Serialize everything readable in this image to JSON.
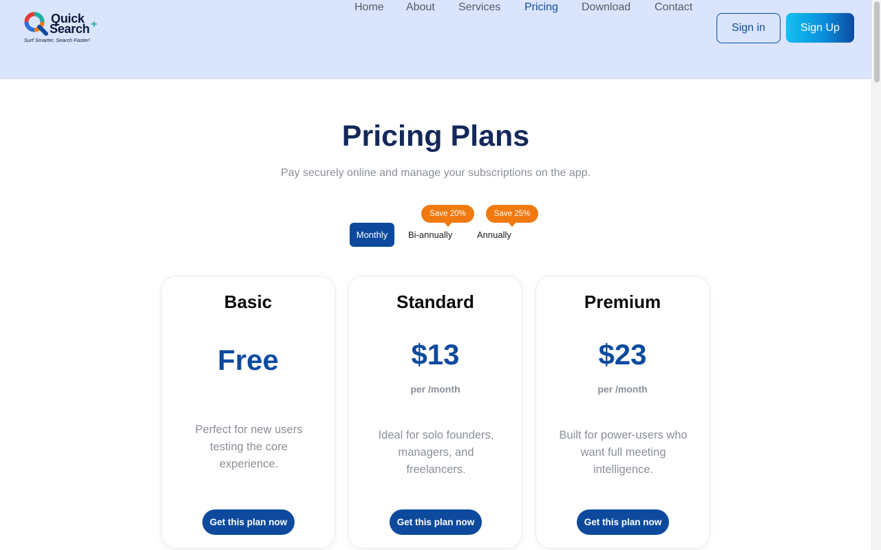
{
  "brand": {
    "name_line1": "Quick",
    "name_line2": "Search",
    "plus": "+",
    "tagline": "Surf Smarter, Search Faster!"
  },
  "nav": {
    "items": [
      {
        "label": "Home"
      },
      {
        "label": "About"
      },
      {
        "label": "Services"
      },
      {
        "label": "Pricing",
        "active": true
      },
      {
        "label": "Download"
      },
      {
        "label": "Contact"
      }
    ],
    "signin_label": "Sign in",
    "signup_label": "Sign Up"
  },
  "hero": {
    "title": "Pricing Plans",
    "subtitle": "Pay securely online and manage your subscriptions on the app."
  },
  "billing": {
    "selected": "Monthly",
    "options": [
      {
        "label": "Monthly",
        "badge": ""
      },
      {
        "label": "Bi-annually",
        "badge": "Save 20%"
      },
      {
        "label": "Annually",
        "badge": "Save 25%"
      }
    ]
  },
  "plans": [
    {
      "name": "Basic",
      "price": "Free",
      "period": "",
      "description": "Perfect for new users testing the core experience.",
      "cta": "Get this plan now"
    },
    {
      "name": "Standard",
      "price": "$13",
      "period": "per /month",
      "description": "Ideal for solo founders, managers, and freelancers.",
      "cta": "Get this plan now"
    },
    {
      "name": "Premium",
      "price": "$23",
      "period": "per /month",
      "description": "Built for power-users who want full meeting intelligence.",
      "cta": "Get this plan now"
    }
  ],
  "colors": {
    "header_bg": "#dae4fd",
    "primary": "#0d4a9e",
    "title": "#14285a",
    "badge": "#f07a10",
    "muted": "#8a8f98"
  }
}
